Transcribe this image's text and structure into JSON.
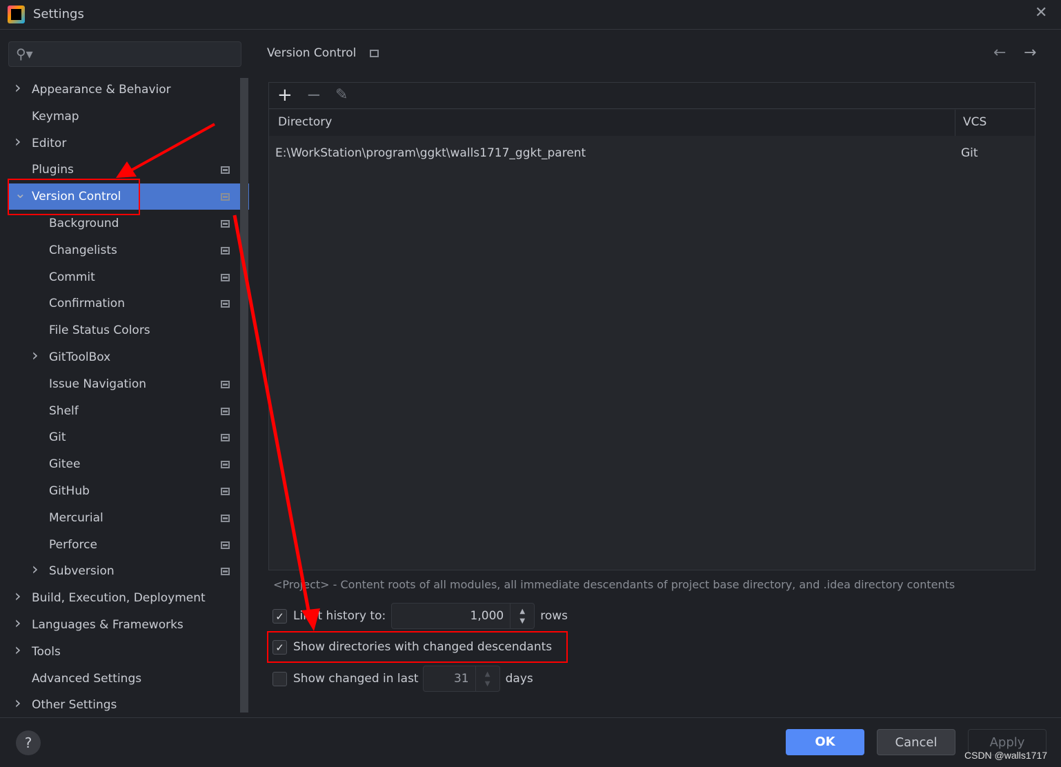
{
  "window": {
    "title": "Settings",
    "close_icon": "close-icon"
  },
  "sidebar": {
    "search_placeholder": "",
    "items": [
      {
        "label": "Appearance & Behavior",
        "level": 0,
        "expandable": true,
        "expanded": false,
        "project": false
      },
      {
        "label": "Keymap",
        "level": 0,
        "expandable": false,
        "project": false
      },
      {
        "label": "Editor",
        "level": 0,
        "expandable": true,
        "expanded": false,
        "project": false
      },
      {
        "label": "Plugins",
        "level": 0,
        "expandable": false,
        "project": true
      },
      {
        "label": "Version Control",
        "level": 0,
        "expandable": true,
        "expanded": true,
        "project": true,
        "selected": true
      },
      {
        "label": "Background",
        "level": 1,
        "project": true
      },
      {
        "label": "Changelists",
        "level": 1,
        "project": true
      },
      {
        "label": "Commit",
        "level": 1,
        "project": true
      },
      {
        "label": "Confirmation",
        "level": 1,
        "project": true
      },
      {
        "label": "File Status Colors",
        "level": 1,
        "project": false
      },
      {
        "label": "GitToolBox",
        "level": 1,
        "expandable": true,
        "expanded": false,
        "project": false
      },
      {
        "label": "Issue Navigation",
        "level": 1,
        "project": true
      },
      {
        "label": "Shelf",
        "level": 1,
        "project": true
      },
      {
        "label": "Git",
        "level": 1,
        "project": true
      },
      {
        "label": "Gitee",
        "level": 1,
        "project": true
      },
      {
        "label": "GitHub",
        "level": 1,
        "project": true
      },
      {
        "label": "Mercurial",
        "level": 1,
        "project": true
      },
      {
        "label": "Perforce",
        "level": 1,
        "project": true
      },
      {
        "label": "Subversion",
        "level": 1,
        "expandable": true,
        "expanded": false,
        "project": true
      },
      {
        "label": "Build, Execution, Deployment",
        "level": 0,
        "expandable": true,
        "project": false
      },
      {
        "label": "Languages & Frameworks",
        "level": 0,
        "expandable": true,
        "project": false
      },
      {
        "label": "Tools",
        "level": 0,
        "expandable": true,
        "project": false
      },
      {
        "label": "Advanced Settings",
        "level": 0,
        "expandable": false,
        "project": false
      },
      {
        "label": "Other Settings",
        "level": 0,
        "expandable": true,
        "project": false
      }
    ]
  },
  "main": {
    "title": "Version Control",
    "table": {
      "columns": [
        "Directory",
        "VCS"
      ],
      "rows": [
        {
          "directory": "E:\\WorkStation\\program\\ggkt\\walls1717_ggkt_parent",
          "vcs": "Git"
        }
      ]
    },
    "note": "<Project> - Content roots of all modules, all immediate descendants of project base directory, and .idea directory contents",
    "limit_history": {
      "label": "Limit history to:",
      "checked": true,
      "value": "1,000",
      "unit": "rows"
    },
    "show_dirs": {
      "label": "Show directories with changed descendants",
      "checked": true
    },
    "show_changed": {
      "label": "Show changed in last",
      "checked": false,
      "value": "31",
      "unit": "days"
    }
  },
  "footer": {
    "help": "?",
    "ok": "OK",
    "cancel": "Cancel",
    "apply": "Apply"
  },
  "watermark": "CSDN @walls1717",
  "colors": {
    "background": "#1f2126",
    "selection": "#4a77cf",
    "primary_button": "#548af7",
    "annotation": "#ff0000"
  }
}
